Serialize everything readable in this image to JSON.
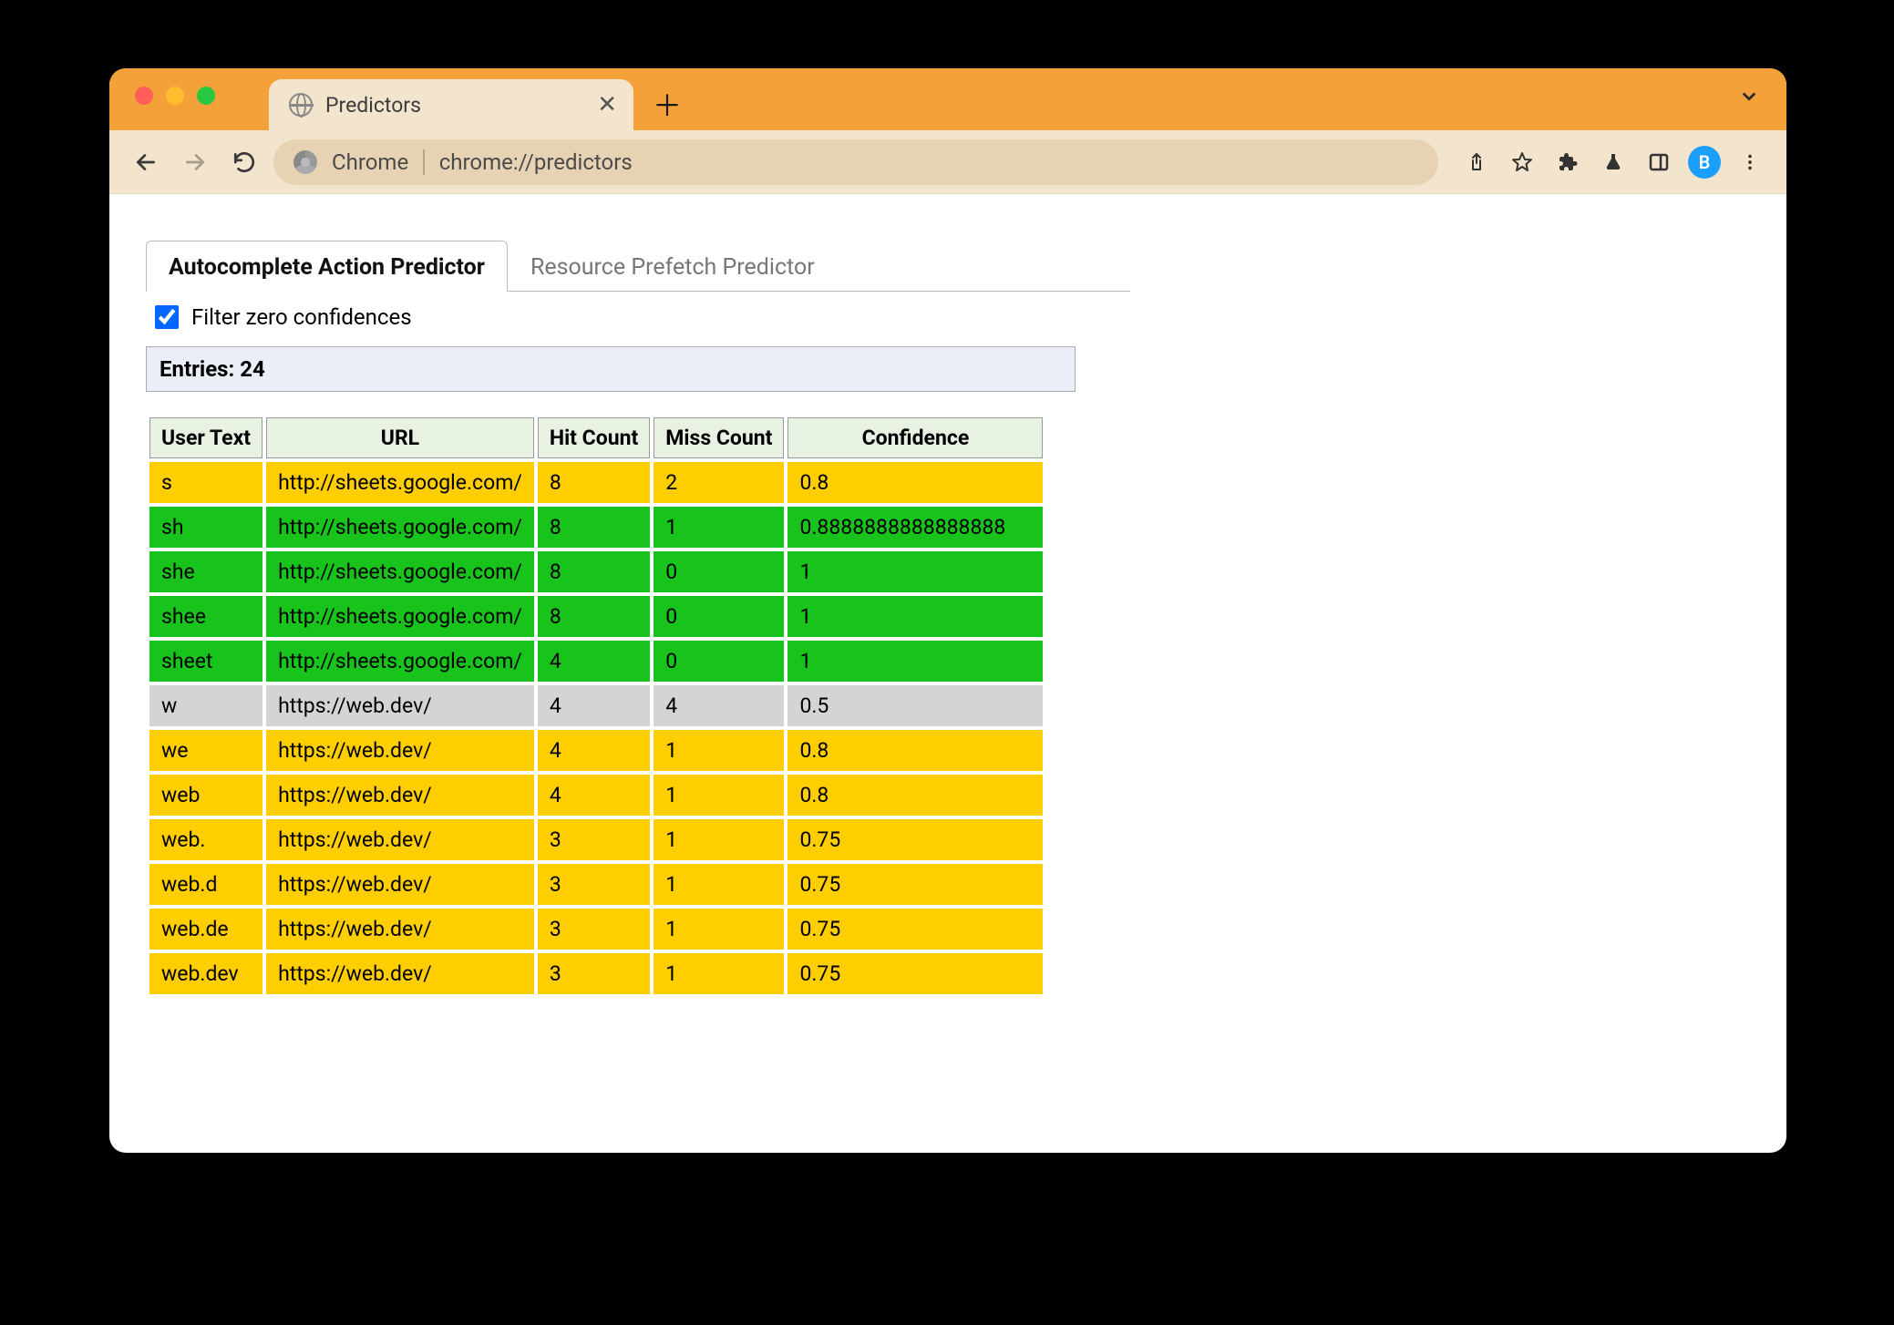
{
  "browser": {
    "tab_title": "Predictors",
    "address_label": "Chrome",
    "address_url": "chrome://predictors",
    "avatar_letter": "B"
  },
  "subtabs": {
    "active": "Autocomplete Action Predictor",
    "inactive": "Resource Prefetch Predictor"
  },
  "filter": {
    "label": "Filter zero confidences",
    "checked": true
  },
  "entries_label": "Entries: 24",
  "columns": {
    "c0": "User Text",
    "c1": "URL",
    "c2": "Hit Count",
    "c3": "Miss Count",
    "c4": "Confidence"
  },
  "rows": [
    {
      "cls": "row-yellow",
      "user_text": "s",
      "url": "http://sheets.google.com/",
      "hit": "8",
      "miss": "2",
      "conf": "0.8"
    },
    {
      "cls": "row-green",
      "user_text": "sh",
      "url": "http://sheets.google.com/",
      "hit": "8",
      "miss": "1",
      "conf": "0.8888888888888888"
    },
    {
      "cls": "row-green",
      "user_text": "she",
      "url": "http://sheets.google.com/",
      "hit": "8",
      "miss": "0",
      "conf": "1"
    },
    {
      "cls": "row-green",
      "user_text": "shee",
      "url": "http://sheets.google.com/",
      "hit": "8",
      "miss": "0",
      "conf": "1"
    },
    {
      "cls": "row-green",
      "user_text": "sheet",
      "url": "http://sheets.google.com/",
      "hit": "4",
      "miss": "0",
      "conf": "1"
    },
    {
      "cls": "row-grey",
      "user_text": "w",
      "url": "https://web.dev/",
      "hit": "4",
      "miss": "4",
      "conf": "0.5"
    },
    {
      "cls": "row-yellow",
      "user_text": "we",
      "url": "https://web.dev/",
      "hit": "4",
      "miss": "1",
      "conf": "0.8"
    },
    {
      "cls": "row-yellow",
      "user_text": "web",
      "url": "https://web.dev/",
      "hit": "4",
      "miss": "1",
      "conf": "0.8"
    },
    {
      "cls": "row-yellow",
      "user_text": "web.",
      "url": "https://web.dev/",
      "hit": "3",
      "miss": "1",
      "conf": "0.75"
    },
    {
      "cls": "row-yellow",
      "user_text": "web.d",
      "url": "https://web.dev/",
      "hit": "3",
      "miss": "1",
      "conf": "0.75"
    },
    {
      "cls": "row-yellow",
      "user_text": "web.de",
      "url": "https://web.dev/",
      "hit": "3",
      "miss": "1",
      "conf": "0.75"
    },
    {
      "cls": "row-yellow",
      "user_text": "web.dev",
      "url": "https://web.dev/",
      "hit": "3",
      "miss": "1",
      "conf": "0.75"
    }
  ]
}
